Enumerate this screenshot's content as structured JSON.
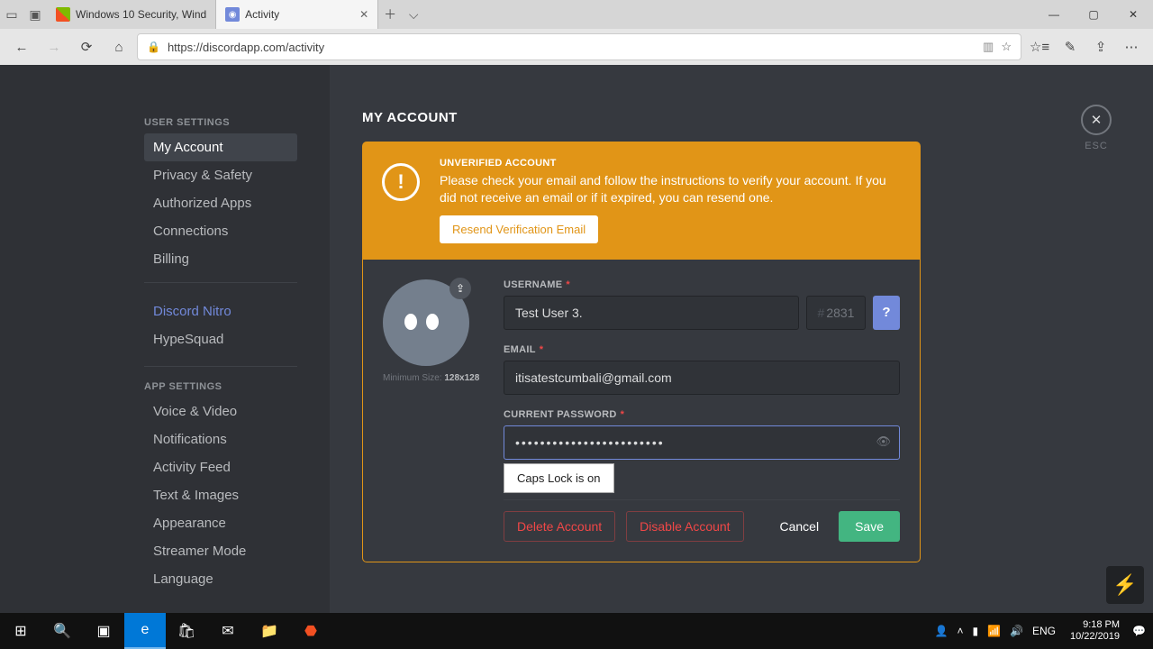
{
  "browser": {
    "tabs": [
      {
        "title": "Windows 10 Security, Wind"
      },
      {
        "title": "Activity"
      }
    ],
    "url": "https://discordapp.com/activity"
  },
  "sidebar": {
    "header1": "USER SETTINGS",
    "items1": [
      "My Account",
      "Privacy & Safety",
      "Authorized Apps",
      "Connections",
      "Billing"
    ],
    "nitro": "Discord Nitro",
    "hypesquad": "HypeSquad",
    "header2": "APP SETTINGS",
    "items2": [
      "Voice & Video",
      "Notifications",
      "Activity Feed",
      "Text & Images",
      "Appearance",
      "Streamer Mode",
      "Language"
    ]
  },
  "close": {
    "esc": "ESC"
  },
  "page_title": "MY ACCOUNT",
  "banner": {
    "title": "UNVERIFIED ACCOUNT",
    "desc": "Please check your email and follow the instructions to verify your account. If you did not receive an email or if it expired, you can resend one.",
    "button": "Resend Verification Email"
  },
  "form": {
    "avatar_hint_prefix": "Minimum Size: ",
    "avatar_hint_size": "128x128",
    "username_label": "USERNAME",
    "username_value": "Test User 3.",
    "discriminator": "2831",
    "email_label": "EMAIL",
    "email_value": "itisatestcumbali@gmail.com",
    "password_label": "CURRENT PASSWORD",
    "password_value": "••••••••••••••••••••••••",
    "capslock": "Caps Lock is on",
    "delete": "Delete Account",
    "disable": "Disable Account",
    "cancel": "Cancel",
    "save": "Save",
    "help": "?",
    "req": "*"
  },
  "taskbar": {
    "lang": "ENG",
    "time": "9:18 PM",
    "date": "10/22/2019"
  }
}
